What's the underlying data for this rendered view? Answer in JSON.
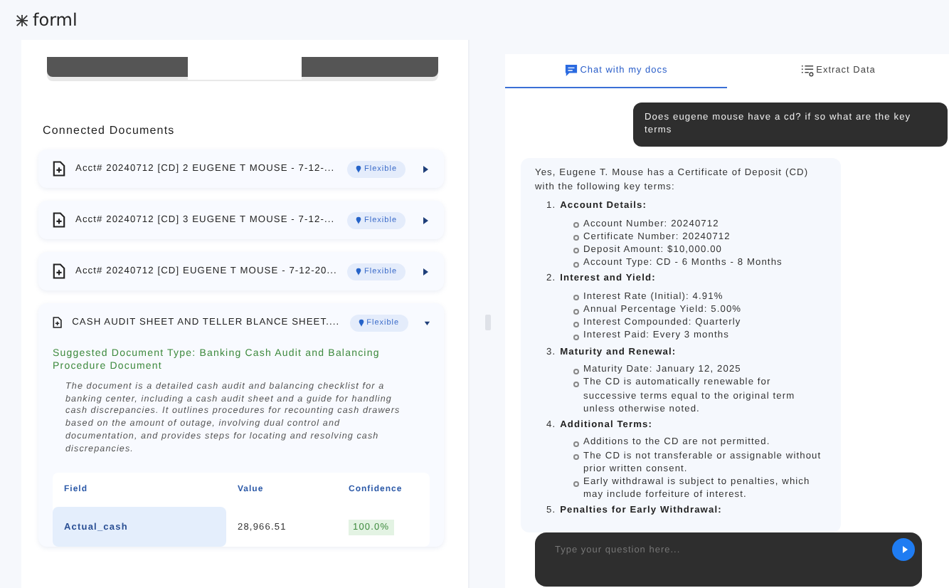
{
  "app": {
    "logo": "forml"
  },
  "connected_documents": {
    "title": "Connected Documents",
    "items": [
      {
        "name": "Acct# 20240712 [CD] 2 EUGENE T MOUSE - 7-12-...",
        "tag": "Flexible",
        "expanded": false
      },
      {
        "name": "Acct# 20240712 [CD] 3 EUGENE T MOUSE - 7-12-...",
        "tag": "Flexible",
        "expanded": false
      },
      {
        "name": "Acct# 20240712 [CD] EUGENE T MOUSE - 7-12-20...",
        "tag": "Flexible",
        "expanded": false
      },
      {
        "name": "CASH AUDIT SHEET AND TELLER BLANCE SHEET....",
        "tag": "Flexible",
        "expanded": true,
        "suggested_type": "Suggested Document Type: Banking Cash Audit and Balancing Procedure Document",
        "summary": "The document is a detailed cash audit and balancing checklist for a banking center, including a cash audit sheet and a guide for handling cash discrepancies. It outlines procedures for recounting cash drawers based on the amount of outage, involving dual control and documentation, and provides steps for locating and resolving cash discrepancies.",
        "table": {
          "columns": [
            "Field",
            "Value",
            "Confidence"
          ],
          "rows": [
            {
              "field": "Actual_cash",
              "value": "28,966.51",
              "confidence": "100.0%"
            }
          ]
        }
      }
    ]
  },
  "chat": {
    "tabs": [
      {
        "label": "Chat with my docs",
        "selected": true
      },
      {
        "label": "Extract Data",
        "selected": false
      }
    ],
    "messages": [
      {
        "kind": "user",
        "text": "Does eugene mouse have a cd? if so what are the key terms"
      },
      {
        "kind": "assistant",
        "intro": "Yes, Eugene T. Mouse has a Certificate of Deposit (CD) with the following key terms:",
        "sections": [
          {
            "number": "1.",
            "title": "Account Details:",
            "items": [
              "Account Number: 20240712",
              "Certificate Number: 20240712",
              "Deposit Amount: $10,000.00",
              "Account Type: CD - 6 Months - 8 Months"
            ]
          },
          {
            "number": "2.",
            "title": "Interest and Yield:",
            "items": [
              "Interest Rate (Initial): 4.91%",
              "Annual Percentage Yield: 5.00%",
              "Interest Compounded: Quarterly",
              "Interest Paid: Every 3 months"
            ]
          },
          {
            "number": "3.",
            "title": "Maturity and Renewal:",
            "items": [
              "Maturity Date: January 12, 2025",
              "The CD is automatically renewable for successive terms equal to the original term unless otherwise noted."
            ]
          },
          {
            "number": "4.",
            "title": "Additional Terms:",
            "items": [
              "Additions to the CD are not permitted.",
              "The CD is not transferable or assignable without prior written consent.",
              "Early withdrawal is subject to penalties, which may include forfeiture of interest."
            ]
          },
          {
            "number": "5.",
            "title": "Penalties for Early Withdrawal:"
          }
        ]
      }
    ],
    "input": {
      "placeholder": "Type your question here..."
    }
  }
}
